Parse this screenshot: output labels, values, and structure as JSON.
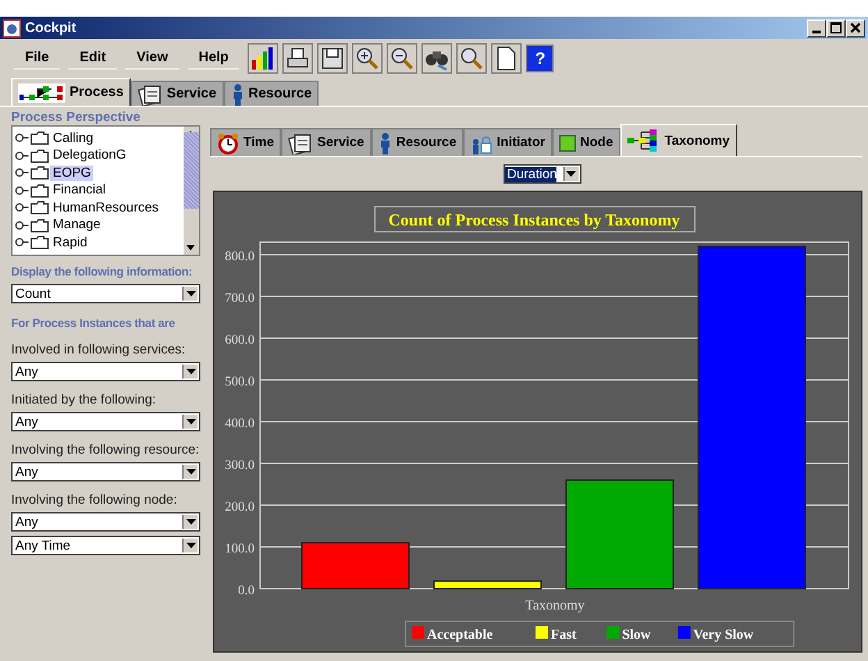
{
  "window": {
    "title": "Cockpit"
  },
  "menu": [
    "File",
    "Edit",
    "View",
    "Help"
  ],
  "toolbar": {
    "help_label": "?"
  },
  "perspective_tabs": [
    {
      "label": "Process",
      "kind": "process",
      "selected": true
    },
    {
      "label": "Service",
      "kind": "service",
      "selected": false
    },
    {
      "label": "Resource",
      "kind": "resource",
      "selected": false
    }
  ],
  "section_title": "Process Perspective",
  "tree": [
    {
      "label": "Calling",
      "selected": false
    },
    {
      "label": "DelegationG",
      "selected": false
    },
    {
      "label": "EOPG",
      "selected": true
    },
    {
      "label": "Financial",
      "selected": false
    },
    {
      "label": "HumanResources",
      "selected": false
    },
    {
      "label": "Manage",
      "selected": false
    },
    {
      "label": "Rapid",
      "selected": false
    }
  ],
  "display_label": "Display the following information:",
  "display_value": "Count",
  "filter_heading": "For Process Instances that are",
  "filters": [
    {
      "label": "Involved in following services:",
      "value": "Any"
    },
    {
      "label": "Initiated by the following:",
      "value": "Any"
    },
    {
      "label": "Involving the following resource:",
      "value": "Any"
    },
    {
      "label": "Involving the following node:",
      "value": "Any"
    },
    {
      "value": "Any Time"
    }
  ],
  "view_tabs": [
    {
      "label": "Time",
      "kind": "time",
      "selected": false
    },
    {
      "label": "Service",
      "kind": "service",
      "selected": false
    },
    {
      "label": "Resource",
      "kind": "resource",
      "selected": false
    },
    {
      "label": "Initiator",
      "kind": "initiator",
      "selected": false
    },
    {
      "label": "Node",
      "kind": "node",
      "selected": false
    },
    {
      "label": "Taxonomy",
      "kind": "taxonomy",
      "selected": true
    }
  ],
  "measure_value": "Duration",
  "chart": {
    "chart_data": {
      "type": "bar",
      "title": "Count of Process Instances by Taxonomy",
      "xlabel": "Taxonomy",
      "grid": true,
      "legend": true,
      "ylim": [
        0,
        830
      ],
      "series": [
        {
          "name": "Acceptable",
          "color": "#ff0000",
          "values": [
            110
          ]
        },
        {
          "name": "Fast",
          "color": "#ffff00",
          "values": [
            18
          ]
        },
        {
          "name": "Slow",
          "color": "#00aa00",
          "values": [
            260
          ]
        },
        {
          "name": "Very Slow",
          "color": "#0000ff",
          "values": [
            820
          ]
        }
      ],
      "yticks": [
        {
          "value": 0,
          "label": "0.0"
        },
        {
          "value": 100,
          "label": "100.0"
        },
        {
          "value": 200,
          "label": "200.0"
        },
        {
          "value": 300,
          "label": "300.0"
        },
        {
          "value": 400,
          "label": "400.0"
        },
        {
          "value": 500,
          "label": "500.0"
        },
        {
          "value": 600,
          "label": "600.0"
        },
        {
          "value": 700,
          "label": "700.0"
        },
        {
          "value": 800,
          "label": "800.0"
        }
      ]
    }
  }
}
